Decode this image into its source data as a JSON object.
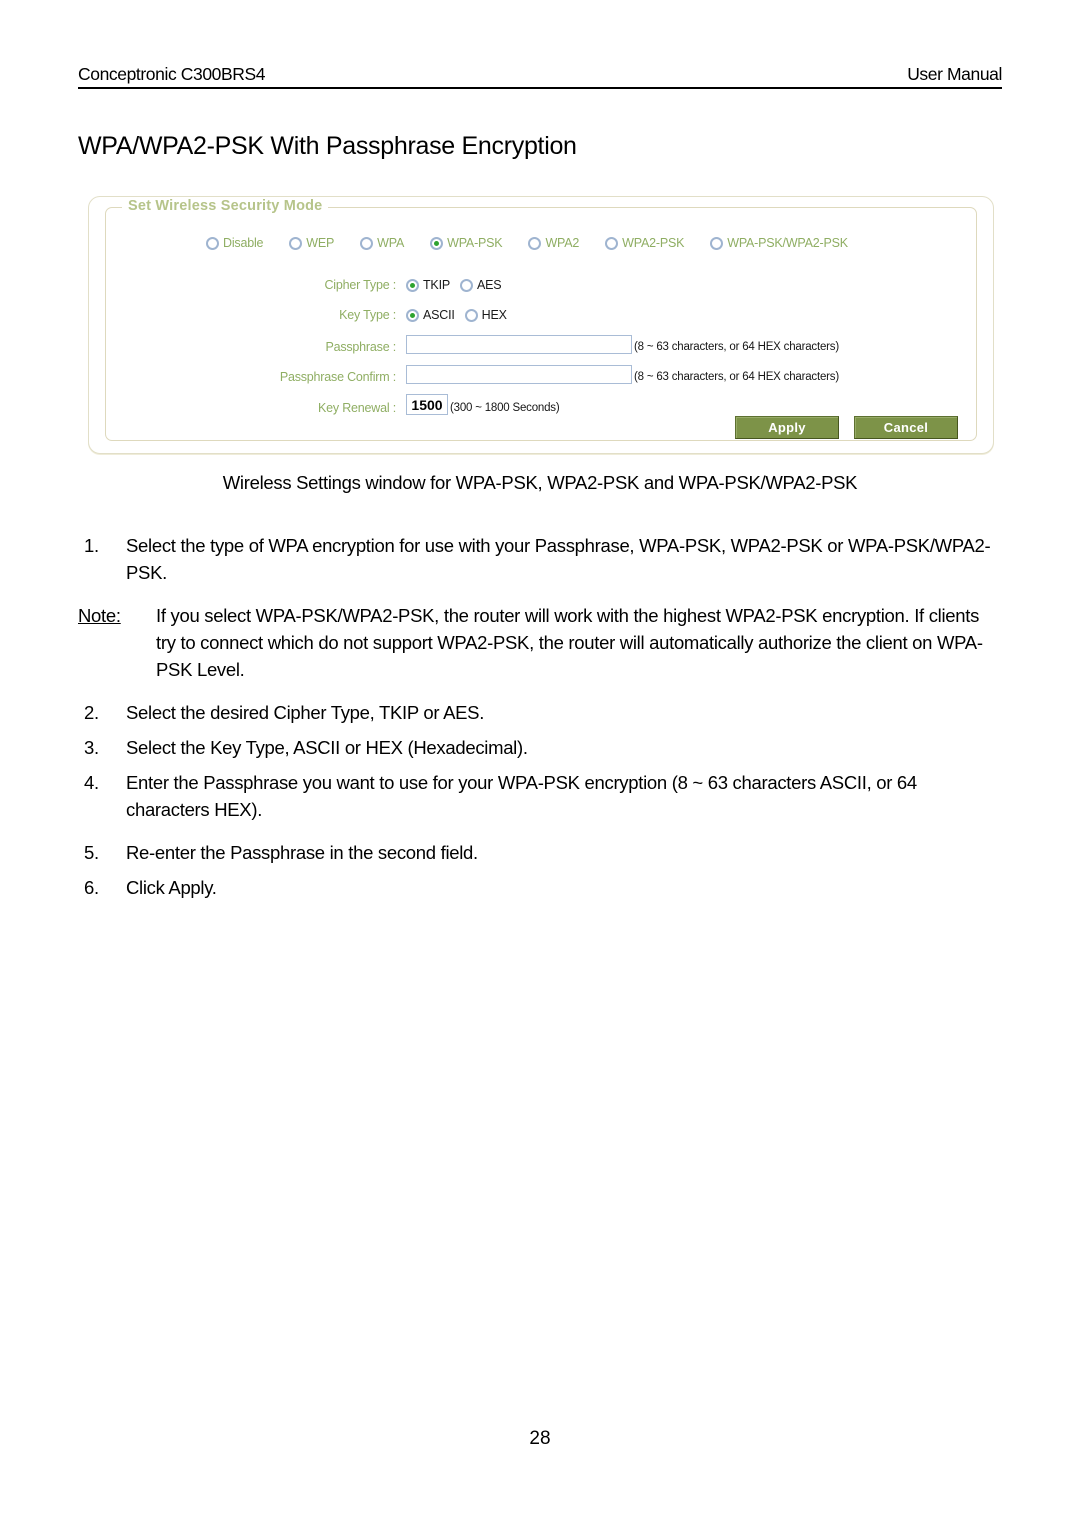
{
  "header": {
    "left": "Conceptronic C300BRS4",
    "right": "User Manual"
  },
  "section": {
    "title": "WPA/WPA2-PSK With Passphrase Encryption"
  },
  "router_ui": {
    "legend": "Set Wireless Security Mode",
    "security_modes": [
      {
        "label": "Disable",
        "selected": false
      },
      {
        "label": "WEP",
        "selected": false
      },
      {
        "label": "WPA",
        "selected": false
      },
      {
        "label": "WPA-PSK",
        "selected": true
      },
      {
        "label": "WPA2",
        "selected": false
      },
      {
        "label": "WPA2-PSK",
        "selected": false
      },
      {
        "label": "WPA-PSK/WPA2-PSK",
        "selected": false
      }
    ],
    "cipher_type": {
      "label": "Cipher Type :",
      "options": [
        {
          "label": "TKIP",
          "selected": true
        },
        {
          "label": "AES",
          "selected": false
        }
      ]
    },
    "key_type": {
      "label": "Key Type :",
      "options": [
        {
          "label": "ASCII",
          "selected": true
        },
        {
          "label": "HEX",
          "selected": false
        }
      ]
    },
    "passphrase": {
      "label": "Passphrase :",
      "value": "",
      "hint": "(8 ~ 63 characters, or 64 HEX characters)"
    },
    "passphrase_confirm": {
      "label": "Passphrase Confirm :",
      "value": "",
      "hint": "(8 ~ 63 characters, or 64 HEX characters)"
    },
    "key_renewal": {
      "label": "Key Renewal :",
      "value": "1500",
      "hint": "(300 ~ 1800 Seconds)"
    },
    "buttons": {
      "apply": "Apply",
      "cancel": "Cancel"
    },
    "colors": {
      "label_green": "#8fae63",
      "legend_green": "#b6c48a",
      "button_olive": "#7d9348",
      "radio_blue": "#9fb4d0",
      "radio_dot_green": "#2fa32f"
    }
  },
  "caption": "Wireless Settings window for WPA-PSK, WPA2-PSK and WPA-PSK/WPA2-PSK",
  "instructions": {
    "item1": {
      "number": "1.",
      "text": "Select the type of WPA encryption for use with your Passphrase, WPA-PSK, WPA2-PSK or WPA-PSK/WPA2-PSK."
    },
    "note": {
      "keyword": "Note:",
      "text": "If you select WPA-PSK/WPA2-PSK, the router will work with the highest WPA2-PSK encryption. If clients try to connect which do not support WPA2-PSK, the router will automatically authorize the client on WPA-PSK Level."
    },
    "item2": {
      "number": "2.",
      "text": "Select the desired Cipher Type, TKIP or AES."
    },
    "item3": {
      "number": "3.",
      "text": "Select the Key Type, ASCII or HEX (Hexadecimal)."
    },
    "item4": {
      "number": "4.",
      "text": "Enter the Passphrase you want to use for your WPA-PSK encryption (8 ~ 63 characters ASCII, or 64 characters HEX)."
    },
    "item5": {
      "number": "5.",
      "text": "Re-enter the Passphrase in the second field."
    },
    "item6": {
      "number": "6.",
      "text": "Click Apply."
    }
  },
  "page_number": "28"
}
